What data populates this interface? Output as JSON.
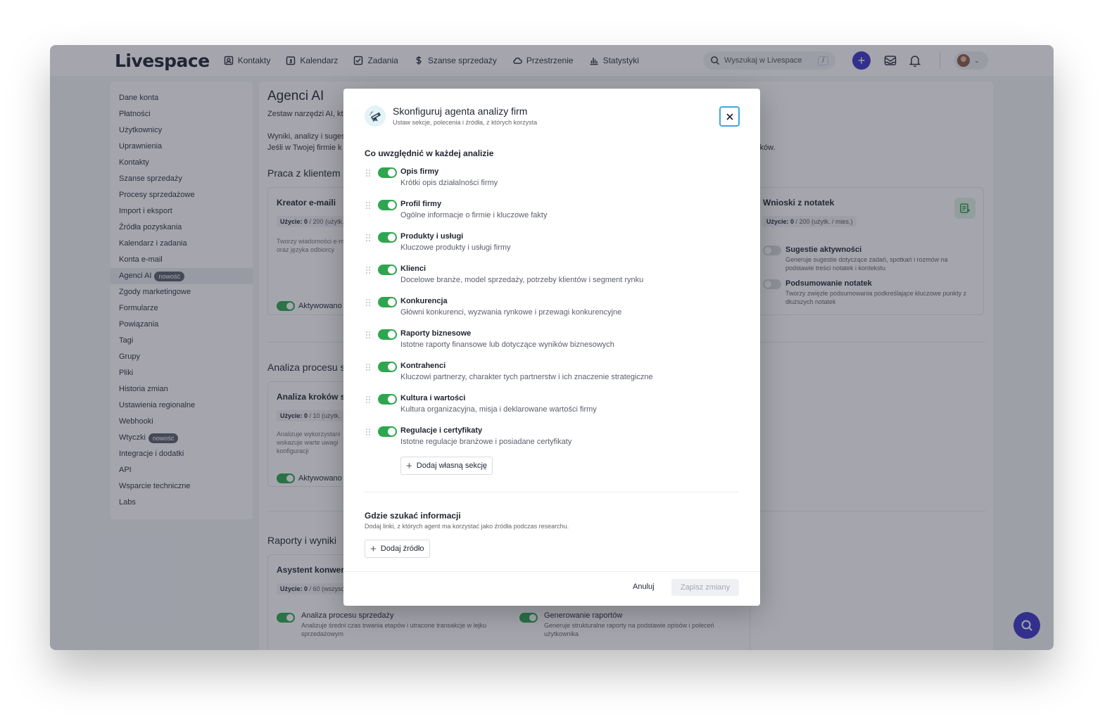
{
  "topbar": {
    "logo": "Livespace",
    "nav": [
      {
        "label": "Kontakty",
        "icon": "contacts-icon"
      },
      {
        "label": "Kalendarz",
        "icon": "calendar-icon"
      },
      {
        "label": "Zadania",
        "icon": "tasks-icon"
      },
      {
        "label": "Szanse sprzedaży",
        "icon": "dollar-icon"
      },
      {
        "label": "Przestrzenie",
        "icon": "cloud-icon"
      },
      {
        "label": "Statystyki",
        "icon": "chart-icon"
      }
    ],
    "search_placeholder": "Wyszukaj w Livespace",
    "search_shortcut": "/",
    "add_label": "+"
  },
  "sidebar": {
    "items": [
      {
        "label": "Dane konta"
      },
      {
        "label": "Płatności"
      },
      {
        "label": "Użytkownicy"
      },
      {
        "label": "Uprawnienia"
      },
      {
        "label": "Kontakty"
      },
      {
        "label": "Szanse sprzedaży"
      },
      {
        "label": "Procesy sprzedażowe"
      },
      {
        "label": "Import i eksport"
      },
      {
        "label": "Źródła pozyskania"
      },
      {
        "label": "Kalendarz i zadania"
      },
      {
        "label": "Konta e-mail"
      },
      {
        "label": "Agenci AI",
        "badge": "nowość",
        "active": true
      },
      {
        "label": "Zgody marketingowe"
      },
      {
        "label": "Formularze"
      },
      {
        "label": "Powiązania"
      },
      {
        "label": "Tagi"
      },
      {
        "label": "Grupy"
      },
      {
        "label": "Pliki"
      },
      {
        "label": "Historia zmian"
      },
      {
        "label": "Ustawienia regionalne"
      },
      {
        "label": "Webhooki"
      },
      {
        "label": "Wtyczki",
        "badge": "nowość"
      },
      {
        "label": "Integracje i dodatki"
      },
      {
        "label": "API"
      },
      {
        "label": "Wsparcie techniczne"
      },
      {
        "label": "Labs"
      }
    ]
  },
  "main": {
    "title": "Agenci AI",
    "subtitle": "Zestaw narzędzi AI, kt",
    "desc1": "Wyniki, analizy i suges",
    "desc2": "Jeśli w Twojej firmie k",
    "desc_tail": "ników.",
    "sections": {
      "clients": "Praca z klientem",
      "process": "Analiza procesu s",
      "reports": "Raporty i wyniki"
    },
    "card_email": {
      "title": "Kreator e-maili",
      "usage_bold": "Użycie: 0",
      "usage_rest": " / 200 (użytk.",
      "desc": "Tworzy wiadomości e-m oraz języka odbiorcy",
      "activated": "Aktywowano"
    },
    "card_notes": {
      "title": "Wnioski z notatek",
      "usage_bold": "Użycie: 0",
      "usage_rest": " / 200 (użytk. / mies.)",
      "opt1_title": "Sugestie aktywności",
      "opt1_desc": "Generuje sugestie dotyczące zadań, spotkań i rozmów na podstawie treści notatek i kontekstu",
      "opt2_title": "Podsumowanie notatek",
      "opt2_desc": "Tworzy zwięzłe podsumowania podkreślające kluczowe punkty z dłuższych notatek"
    },
    "card_steps": {
      "title": "Analiza kroków s",
      "usage_bold": "Użycie: 0",
      "usage_rest": " / 10 (użytk.",
      "desc": "Analizuje wykorzystani wskazuje warte uwagi konfiguracji",
      "activated": "Aktywowano"
    },
    "card_assistant": {
      "title": "Asystent konwer",
      "usage_bold": "Użycie: 0",
      "usage_rest": " / 60 (wszysc",
      "opt1_title": "Analiza procesu sprzedaży",
      "opt1_desc": "Analizuje średni czas trwania etapów i utracone transakcje w lejku sprzedażowym",
      "opt2_title": "Generowanie raportów",
      "opt2_desc": "Generuje strukturalne raporty na podstawie opisów i poleceń użytkownika"
    }
  },
  "modal": {
    "title": "Skonfiguruj agenta analizy firm",
    "subtitle": "Ustaw sekcje, polecenia i źródła, z których korzysta",
    "section_heading": "Co uwzględnić w każdej analizie",
    "sections": [
      {
        "title": "Opis firmy",
        "desc": "Krótki opis działalności firmy",
        "enabled": true
      },
      {
        "title": "Profil firmy",
        "desc": "Ogólne informacje o firmie i kluczowe fakty",
        "enabled": true
      },
      {
        "title": "Produkty i usługi",
        "desc": "Kluczowe produkty i usługi firmy",
        "enabled": true
      },
      {
        "title": "Klienci",
        "desc": "Docelowe branże, model sprzedaży, potrzeby klientów i segment rynku",
        "enabled": true
      },
      {
        "title": "Konkurencja",
        "desc": "Główni konkurenci, wyzwania rynkowe i przewagi konkurencyjne",
        "enabled": true
      },
      {
        "title": "Raporty biznesowe",
        "desc": "Istotne raporty finansowe lub dotyczące wyników biznesowych",
        "enabled": true
      },
      {
        "title": "Kontrahenci",
        "desc": "Kluczowi partnerzy, charakter tych partnerstw i ich znaczenie strategiczne",
        "enabled": true
      },
      {
        "title": "Kultura i wartości",
        "desc": "Kultura organizacyjna, misja i deklarowane wartości firmy",
        "enabled": true
      },
      {
        "title": "Regulacje i certyfikaty",
        "desc": "Istotne regulacje branżowe i posiadane certyfikaty",
        "enabled": true
      }
    ],
    "add_section_label": "Dodaj własną sekcję",
    "sources_title": "Gdzie szukać informacji",
    "sources_desc": "Dodaj linki, z których agent ma korzystać jako źródła podczas researchu.",
    "add_source_label": "Dodaj źródło",
    "cancel_label": "Anuluj",
    "save_label": "Zapisz zmiany"
  },
  "colors": {
    "accent": "#3b35c9",
    "toggle_on": "#2ea64f",
    "focus_ring": "#3da7e0"
  }
}
